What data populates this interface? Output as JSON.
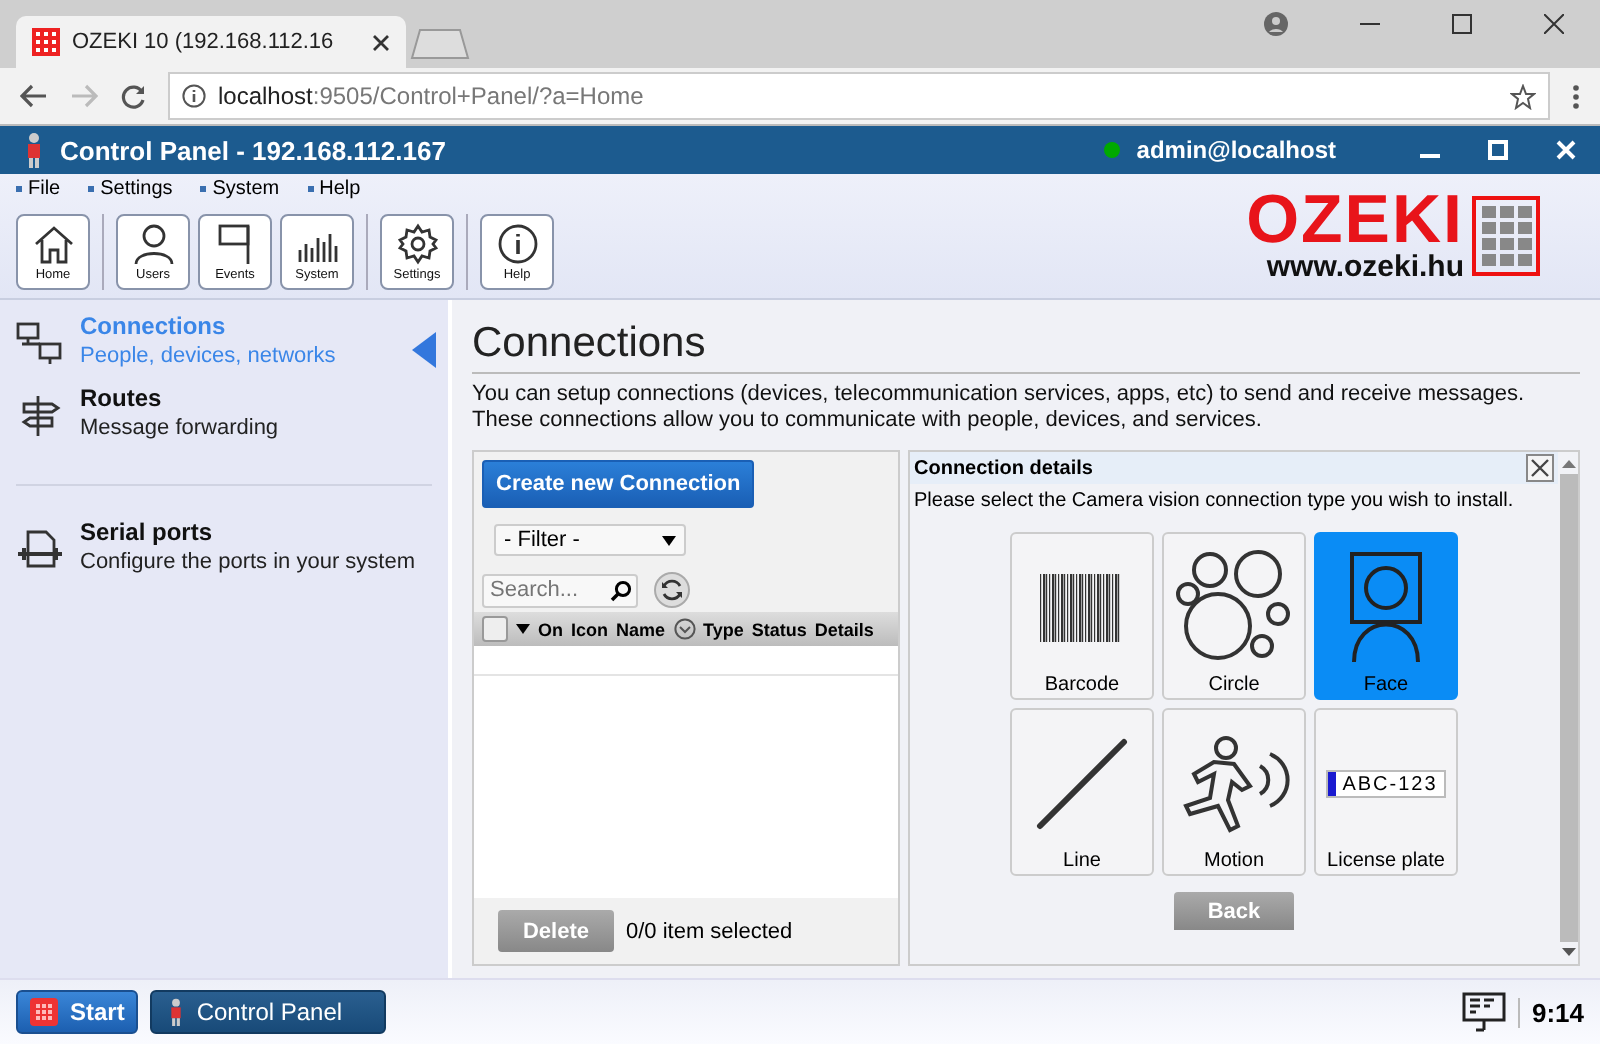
{
  "browser": {
    "tab_title": "OZEKI 10 (192.168.112.16",
    "url_host": "localhost",
    "url_rest": ":9505/Control+Panel/?a=Home"
  },
  "app": {
    "title": "Control Panel - 192.168.112.167",
    "user": "admin@localhost",
    "online": true
  },
  "menu": [
    "File",
    "Settings",
    "System",
    "Help"
  ],
  "toolbar": [
    [
      {
        "label": "Home",
        "kind": "home"
      }
    ],
    [
      {
        "label": "Users",
        "kind": "users"
      },
      {
        "label": "Events",
        "kind": "events"
      },
      {
        "label": "System",
        "kind": "system"
      }
    ],
    [
      {
        "label": "Settings",
        "kind": "settings"
      }
    ],
    [
      {
        "label": "Help",
        "kind": "help"
      }
    ]
  ],
  "logo": {
    "brand": "OZEKI",
    "url": "www.ozeki.hu"
  },
  "sidebar": {
    "items": [
      {
        "title": "Connections",
        "subtitle": "People, devices, networks",
        "kind": "connections",
        "selected": true
      },
      {
        "title": "Routes",
        "subtitle": "Message forwarding",
        "kind": "routes",
        "selected": false
      },
      {
        "title": "Serial ports",
        "subtitle": "Configure the ports in your system",
        "kind": "serial",
        "selected": false
      }
    ]
  },
  "page": {
    "heading": "Connections",
    "description": [
      "You can setup connections (devices, telecommunication services, apps, etc) to send and receive messages.",
      "These connections allow you to communicate with people, devices, and services."
    ]
  },
  "list_panel": {
    "select_all_checked": false,
    "create_button": "Create new Connection",
    "filter": "- Filter -",
    "search_placeholder": "Search...",
    "columns": [
      "On",
      "Icon",
      "Name",
      "Type",
      "Status",
      "Details"
    ],
    "delete_button": "Delete",
    "selection": "0/0 item selected"
  },
  "details": {
    "title": "Connection details",
    "prompt": "Please select the Camera vision connection type you wish to install.",
    "options": [
      {
        "label": "Barcode",
        "kind": "barcode",
        "selected": false
      },
      {
        "label": "Circle",
        "kind": "circle",
        "selected": false
      },
      {
        "label": "Face",
        "kind": "face",
        "selected": true
      },
      {
        "label": "Line",
        "kind": "line",
        "selected": false
      },
      {
        "label": "Motion",
        "kind": "motion",
        "selected": false
      },
      {
        "label": "License plate",
        "kind": "plate",
        "plate": "ABC-123",
        "selected": false
      }
    ],
    "back_button": "Back"
  },
  "taskbar": {
    "start": "Start",
    "window": "Control Panel",
    "clock": "9:14"
  }
}
